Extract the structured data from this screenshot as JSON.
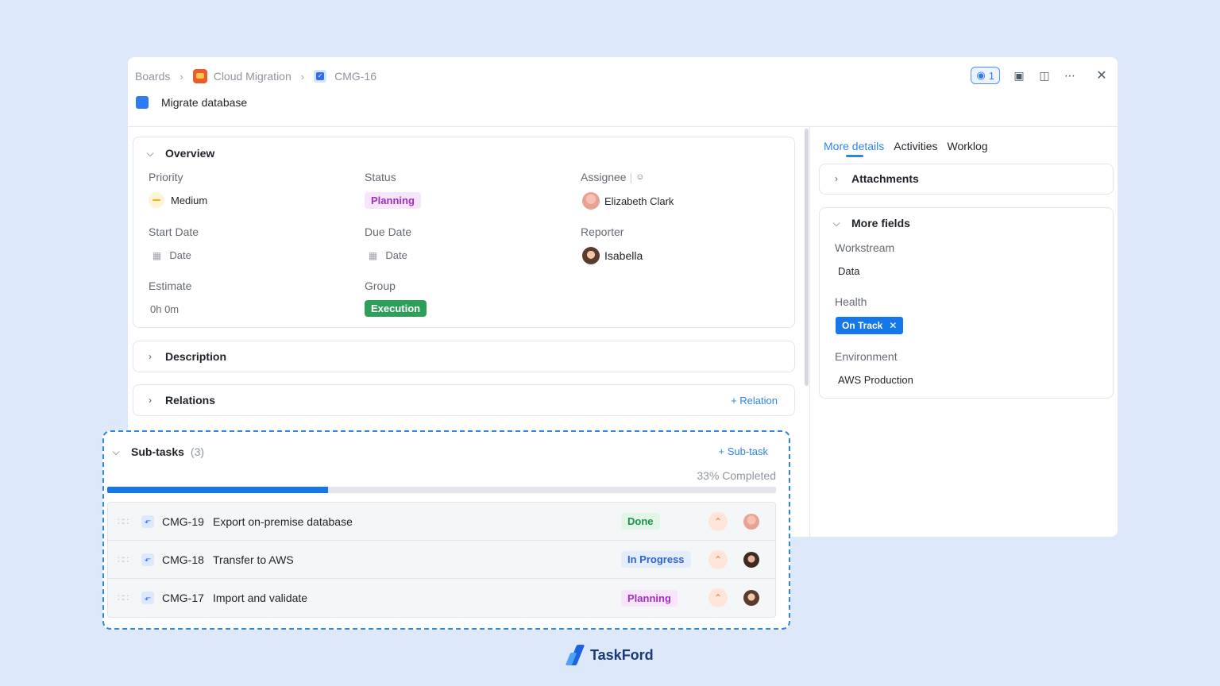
{
  "breadcrumb": {
    "boards": "Boards",
    "project": "Cloud Migration",
    "task_key": "CMG-16"
  },
  "task": {
    "title": "Migrate database"
  },
  "header_actions": {
    "watchers_count": "1"
  },
  "overview": {
    "heading": "Overview",
    "priority_label": "Priority",
    "priority_value": "Medium",
    "status_label": "Status",
    "status_value": "Planning",
    "assignee_label": "Assignee",
    "assignee_value": "Elizabeth Clark",
    "start_label": "Start Date",
    "start_value": "Date",
    "due_label": "Due Date",
    "due_value": "Date",
    "reporter_label": "Reporter",
    "reporter_value": "Isabella",
    "estimate_label": "Estimate",
    "estimate_value": "0h 0m",
    "group_label": "Group",
    "group_value": "Execution"
  },
  "description": {
    "heading": "Description"
  },
  "relations": {
    "heading": "Relations",
    "add_label": "Relation"
  },
  "subtasks": {
    "heading": "Sub-tasks",
    "count": "(3)",
    "add_label": "Sub-task",
    "progress_text": "33% Completed",
    "progress": 0.33,
    "items": [
      {
        "key": "CMG-19",
        "title": "Export on-premise database",
        "status": "Done"
      },
      {
        "key": "CMG-18",
        "title": "Transfer to AWS",
        "status": "In Progress"
      },
      {
        "key": "CMG-17",
        "title": "Import and validate",
        "status": "Planning"
      }
    ]
  },
  "right_panel": {
    "tabs": [
      "More details",
      "Activities",
      "Worklog"
    ],
    "attachments_heading": "Attachments",
    "more_fields_heading": "More fields",
    "workstream_label": "Workstream",
    "workstream_value": "Data",
    "health_label": "Health",
    "health_value": "On Track",
    "environment_label": "Environment",
    "environment_value": "AWS Production"
  },
  "brand": {
    "name": "TaskFord"
  },
  "colors": {
    "accent": "#2f86e8",
    "progress": "#1677e8",
    "background": "#dde9fa"
  }
}
